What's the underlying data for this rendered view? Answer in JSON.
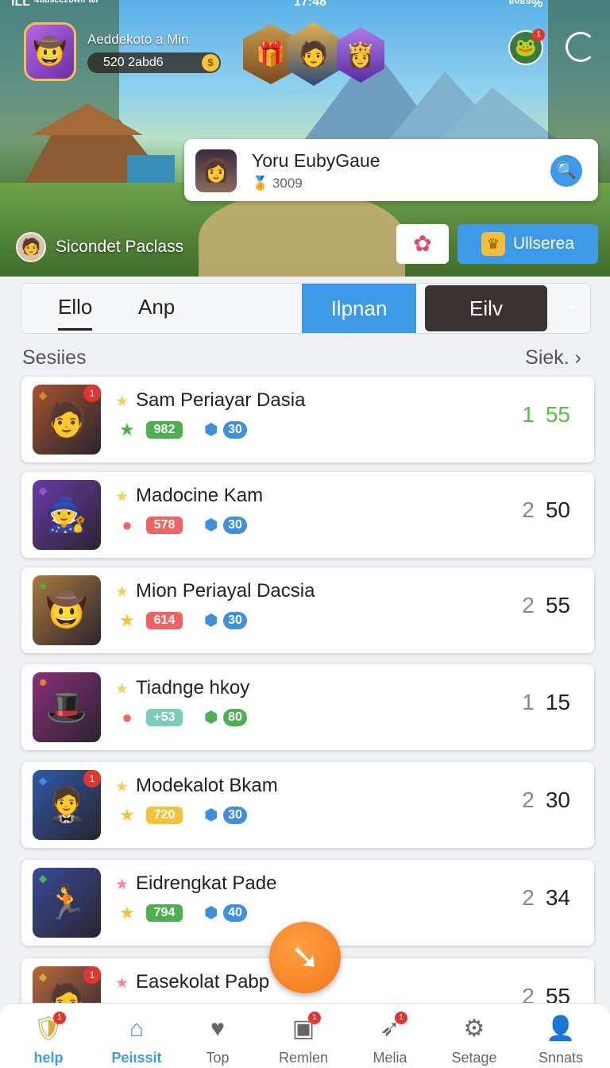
{
  "status_bar": {
    "left": "ILL ⁴ᵃᵈˢᵉᵉᶻᵒʷⁿ ᵃᶦᶠ",
    "time": "17:48",
    "right": "⁸⁰⁸⁹%"
  },
  "profile": {
    "name": "Aeddekoto a Min",
    "coins": "520 2abd6",
    "coin_icon": "coin-icon"
  },
  "search_card": {
    "title": "Yoru EubyGaue",
    "points": "3009",
    "button_icon": "search-icon"
  },
  "place": {
    "label": "Sicondet Paclass"
  },
  "unlock_button": {
    "label": "Ullserea",
    "icon": "crown-icon"
  },
  "gift_button": {
    "icon": "gift-icon"
  },
  "tabs": {
    "a": "Ello",
    "b": "Anp",
    "c": "Ilpnan",
    "d": "Eilv",
    "more_icon": "chevron-down-icon"
  },
  "section": {
    "title": "Sesiies",
    "link": "Siek. ›"
  },
  "list": [
    {
      "name": "Sam Periayar Dasia",
      "stat": "982",
      "gem": "30",
      "rank_a": "1",
      "rank_b": "55",
      "stat_color": "#4caf50",
      "gem_color": "#3d8fe0",
      "star_color": "#f2cf5a",
      "thumb": "#a6532b"
    },
    {
      "name": "Madocine Kam",
      "stat": "578",
      "gem": "30",
      "rank_a": "2",
      "rank_b": "50",
      "stat_color": "#ef6461",
      "gem_color": "#3d8fe0",
      "star_color": "#f2cf5a",
      "thumb": "#6a3aa8"
    },
    {
      "name": "Mion Periayal Dacsia",
      "stat": "614",
      "gem": "30",
      "rank_a": "2",
      "rank_b": "55",
      "stat_color": "#ef6461",
      "gem_color": "#3d8fe0",
      "star_color": "#f2cf5a",
      "thumb": "#a97a3c"
    },
    {
      "name": "Tiadnge hkoy",
      "stat": "+53",
      "gem": "80",
      "rank_a": "1",
      "rank_b": "15",
      "stat_color": "#7ccdb8",
      "gem_color": "#4caf50",
      "star_color": "#f2cf5a",
      "thumb": "#8a2f7a"
    },
    {
      "name": "Modekalot Bkam",
      "stat": "720",
      "gem": "30",
      "rank_a": "2",
      "rank_b": "30",
      "stat_color": "#f2c33a",
      "gem_color": "#3d8fe0",
      "star_color": "#f2cf5a",
      "thumb": "#2d5aa8"
    },
    {
      "name": "Eidrengkat Pade",
      "stat": "794",
      "gem": "40",
      "rank_a": "2",
      "rank_b": "34",
      "stat_color": "#4caf50",
      "gem_color": "#3d8fe0",
      "star_color": "#f08a9a",
      "thumb": "#3a4a9a"
    },
    {
      "name": "Easekolat Pabp",
      "stat": "",
      "gem": "",
      "rank_a": "2",
      "rank_b": "55",
      "stat_color": "#ef6461",
      "gem_color": "#3d8fe0",
      "star_color": "#f08a9a",
      "thumb": "#b86a3a"
    }
  ],
  "nav": [
    {
      "label": "help",
      "icon": "shield-icon",
      "badge": "1"
    },
    {
      "label": "Peiıssit",
      "icon": "home-icon",
      "badge": ""
    },
    {
      "label": "Top",
      "icon": "heart-icon",
      "badge": ""
    },
    {
      "label": "Remlen",
      "icon": "monitor-icon",
      "badge": "1"
    },
    {
      "label": "Melia",
      "icon": "rocket-icon",
      "badge": "1"
    },
    {
      "label": "Setage",
      "icon": "gear-icon",
      "badge": ""
    },
    {
      "label": "Snnats",
      "icon": "user-icon",
      "badge": ""
    }
  ],
  "fab": {
    "icon": "arrow-icon"
  }
}
